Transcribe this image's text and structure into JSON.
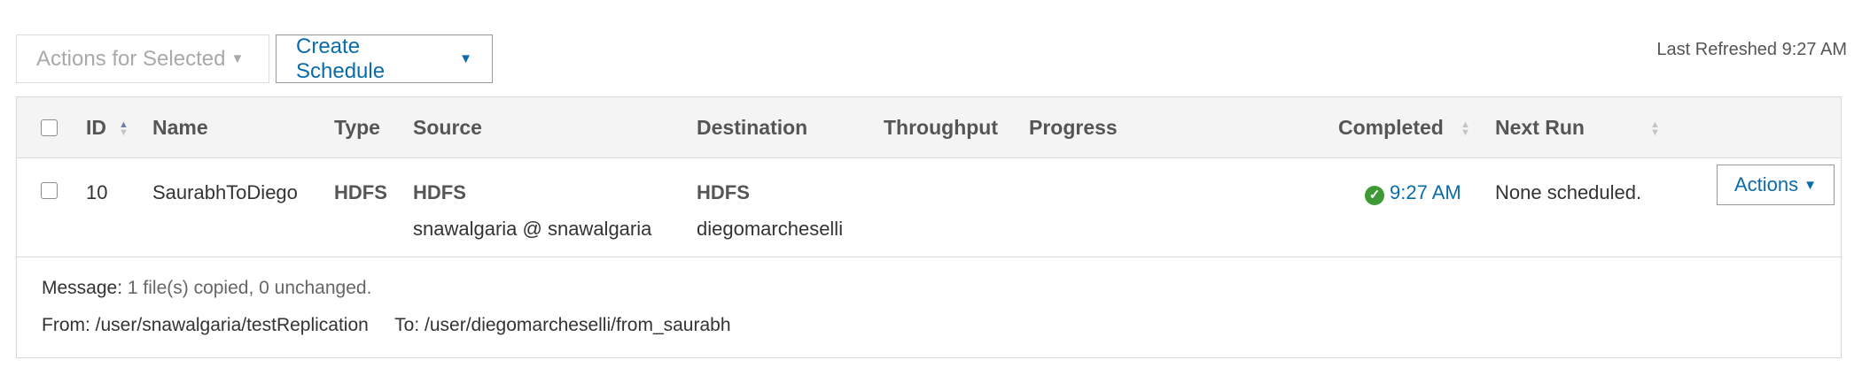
{
  "toolbar": {
    "actions_label": "Actions for Selected",
    "create_label": "Create Schedule"
  },
  "last_refreshed": "Last Refreshed 9:27 AM",
  "table": {
    "columns": {
      "id": "ID",
      "name": "Name",
      "type": "Type",
      "source": "Source",
      "destination": "Destination",
      "throughput": "Throughput",
      "progress": "Progress",
      "completed": "Completed",
      "next_run": "Next Run"
    },
    "rows": [
      {
        "id": "10",
        "name": "SaurabhToDiego",
        "type": "HDFS",
        "source_type": "HDFS",
        "source_detail": "snawalgaria @ snawalgaria",
        "destination_type": "HDFS",
        "destination_detail": "diegomarcheselli",
        "throughput": "",
        "progress": "",
        "completed": "9:27 AM",
        "completed_status": "success",
        "next_run": "None scheduled.",
        "actions_label": "Actions"
      }
    ]
  },
  "message": {
    "message_label": "Message:",
    "message_value": "1 file(s) copied, 0 unchanged.",
    "from_label": "From:",
    "from_value": "/user/snawalgaria/testReplication",
    "to_label": "To:",
    "to_value": "/user/diegomarcheselli/from_saurabh"
  },
  "colors": {
    "link": "#0a6ca8",
    "success": "#3d9a36"
  },
  "icons": {
    "success": "check-circle-icon",
    "dropdown": "caret-down-icon",
    "sort": "sort-arrows-icon"
  }
}
